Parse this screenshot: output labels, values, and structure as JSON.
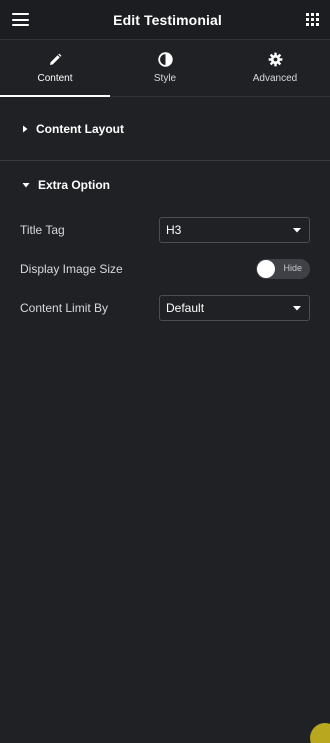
{
  "header": {
    "title": "Edit Testimonial",
    "menu_icon": "hamburger-icon",
    "apps_icon": "grid-icon"
  },
  "tabs": [
    {
      "label": "Content",
      "icon": "pencil-icon",
      "active": true
    },
    {
      "label": "Style",
      "icon": "half-circle-icon",
      "active": false
    },
    {
      "label": "Advanced",
      "icon": "gear-icon",
      "active": false
    }
  ],
  "sections": {
    "content_layout": {
      "label": "Content Layout",
      "expanded": false
    },
    "extra_option": {
      "label": "Extra Option",
      "expanded": true
    }
  },
  "controls": {
    "title_tag": {
      "label": "Title Tag",
      "value": "H3"
    },
    "display_image_size": {
      "label": "Display Image Size",
      "toggle_text": "Hide",
      "on": false
    },
    "content_limit_by": {
      "label": "Content Limit By",
      "value": "Default"
    }
  },
  "colors": {
    "background": "#202124",
    "header": "#1c1d21",
    "accent_fab": "#b8a71f"
  }
}
